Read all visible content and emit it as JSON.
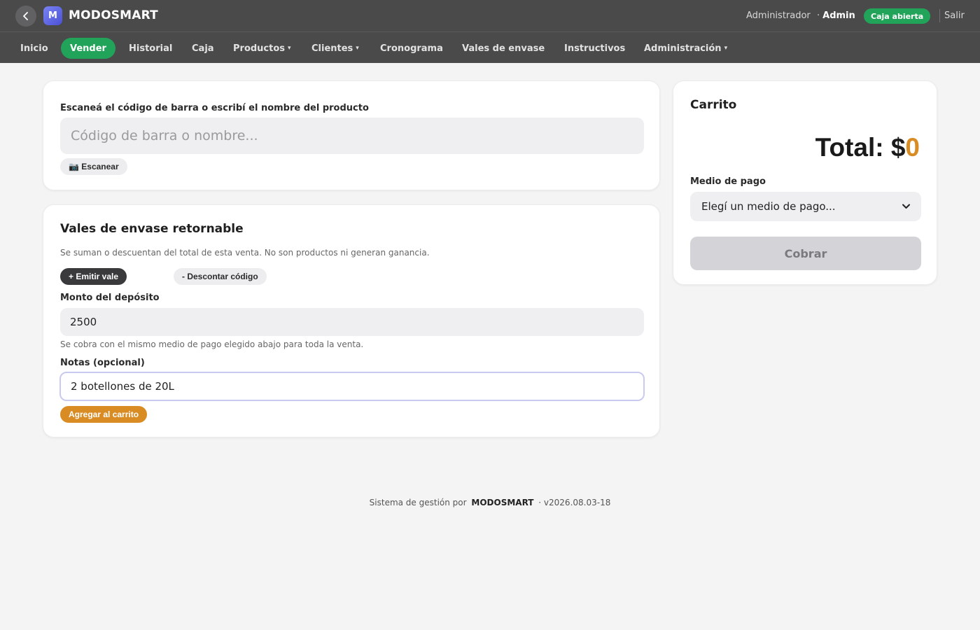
{
  "header": {
    "brand": "MODOSMART",
    "logo_letter": "M",
    "user_role": "Administrador",
    "user_name": "Admin",
    "caja_status": "Caja abierta",
    "logout": "Salir"
  },
  "nav": {
    "inicio": "Inicio",
    "vender": "Vender",
    "historial": "Historial",
    "caja": "Caja",
    "productos": "Productos",
    "clientes": "Clientes",
    "cronograma": "Cronograma",
    "vales": "Vales de envase",
    "instructivos": "Instructivos",
    "administracion": "Administración",
    "caret": "▾"
  },
  "scan": {
    "label": "Escaneá el código de barra o escribí el nombre del producto",
    "placeholder": "Código de barra o nombre...",
    "button": "📷 Escanear"
  },
  "vales": {
    "title": "Vales de envase retornable",
    "description": "Se suman o descuentan del total de esta venta. No son productos ni generan ganancia.",
    "emit_button": "+ Emitir vale",
    "discount_button": "- Descontar código",
    "deposit_label": "Monto del depósito",
    "deposit_value": "2500",
    "deposit_help": "Se cobra con el mismo medio de pago elegido abajo para toda la venta.",
    "notes_label": "Notas (opcional)",
    "notes_value": "2 botellones de 20L",
    "add_button": "Agregar al carrito"
  },
  "cart": {
    "title": "Carrito",
    "total_label": "Total: $",
    "total_value": "0",
    "payment_label": "Medio de pago",
    "payment_placeholder": "Elegí un medio de pago...",
    "charge_button": "Cobrar"
  },
  "footer": {
    "prefix": "Sistema de gestión por",
    "brand": "MODOSMART",
    "version": "· v2026.08.03-18"
  },
  "colors": {
    "accent_green": "#22a35a",
    "accent_orange": "#d98c24",
    "header_bg": "#4a4a4b"
  }
}
